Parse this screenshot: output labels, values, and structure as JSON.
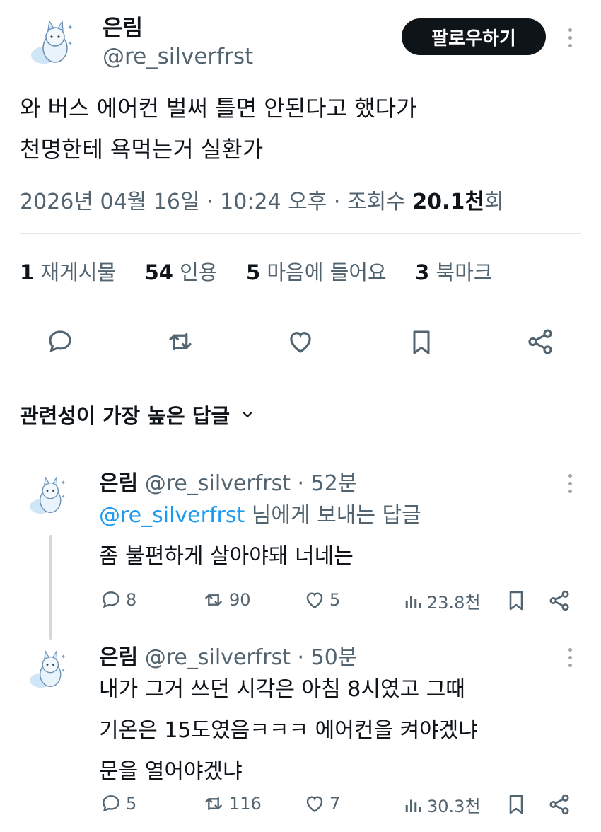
{
  "main_tweet": {
    "name": "은림",
    "handle": "@re_silverfrst",
    "follow_label": "팔로우하기",
    "text_line1": "와 버스 에어컨 벌써 틀면 안된다고 했다가",
    "text_line2": "천명한테 욕먹는거 실환가",
    "meta_time": "2026년 04월 16일 · 10:24 오후 · 조회수 ",
    "meta_views": "20.1천",
    "meta_views_suffix": "회",
    "stats": {
      "reposts_count": "1",
      "reposts_label": "재게시물",
      "quotes_count": "54",
      "quotes_label": "인용",
      "likes_count": "5",
      "likes_label": "마음에 들어요",
      "bookmarks_count": "3",
      "bookmarks_label": "북마크"
    }
  },
  "sort": {
    "label": "관련성이 가장 높은 답글"
  },
  "replies": [
    {
      "name": "은림",
      "handle": "@re_silverfrst · 52분",
      "reply_to_mention": "@re_silverfrst",
      "reply_to_suffix": " 님에게 보내는 답글",
      "text_line1": "좀 불편하게 살아야돼 너네는",
      "comments": "8",
      "reposts": "90",
      "likes": "5",
      "views": "23.8천"
    },
    {
      "name": "은림",
      "handle": "@re_silverfrst · 50분",
      "text_line1": "내가 그거 쓰던 시각은 아침 8시였고 그때",
      "text_line2": "기온은 15도였음ㅋㅋㅋ 에어컨을 켜야겠냐",
      "text_line3": "문을 열어야겠냐",
      "comments": "5",
      "reposts": "116",
      "likes": "7",
      "views": "30.3천"
    }
  ],
  "colors": {
    "accent": "#1d9bf0",
    "text": "#0f1419",
    "muted": "#536471"
  }
}
